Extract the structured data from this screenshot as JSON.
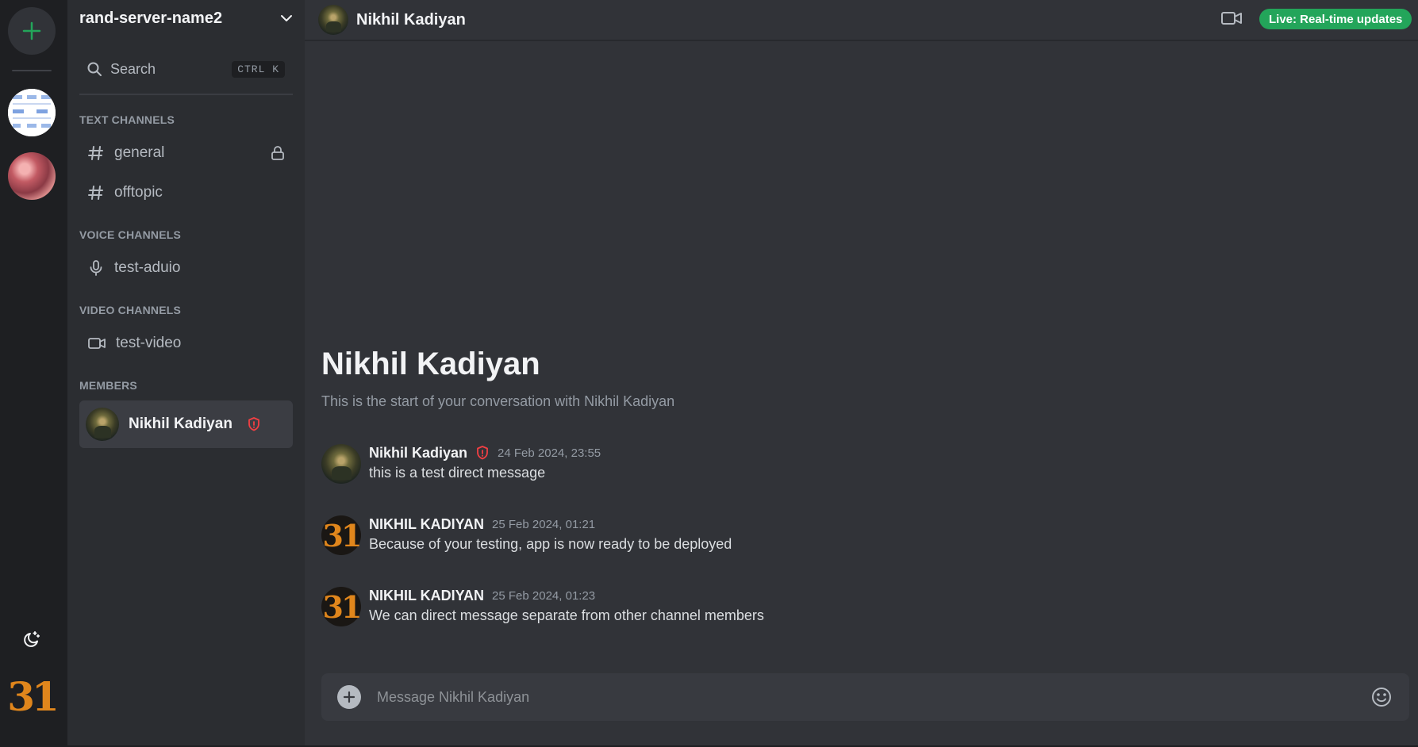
{
  "app": {
    "server_name": "rand-server-name2",
    "user_logo_text": "31"
  },
  "search": {
    "label": "Search",
    "shortcut": "CTRL  K"
  },
  "sections": {
    "text": "TEXT CHANNELS",
    "voice": "VOICE CHANNELS",
    "video": "VIDEO CHANNELS",
    "members": "MEMBERS"
  },
  "channels": {
    "text": [
      {
        "name": "general",
        "locked": true
      },
      {
        "name": "offtopic",
        "locked": false
      }
    ],
    "voice": [
      {
        "name": "test-aduio"
      }
    ],
    "video": [
      {
        "name": "test-video"
      }
    ]
  },
  "members": [
    {
      "name": "Nikhil Kadiyan",
      "role_icon": "shield-alert-icon"
    }
  ],
  "conversation": {
    "header_name": "Nikhil Kadiyan",
    "live_badge": "Live: Real-time updates",
    "welcome_title": "Nikhil Kadiyan",
    "welcome_subtitle": "This is the start of your conversation with Nikhil Kadiyan",
    "messages": [
      {
        "author": "Nikhil Kadiyan",
        "badge": "shield-alert-icon",
        "time": "24 Feb 2024, 23:55",
        "text": "this is a test direct message",
        "avatar": "photo"
      },
      {
        "author": "NIKHIL KADIYAN",
        "time": "25 Feb 2024, 01:21",
        "text": "Because of your testing, app is now ready to be deployed",
        "avatar": "31"
      },
      {
        "author": "NIKHIL KADIYAN",
        "time": "25 Feb 2024, 01:23",
        "text": "We can direct message separate from other channel members",
        "avatar": "31"
      }
    ],
    "composer_placeholder": "Message Nikhil Kadiyan"
  },
  "colors": {
    "accent_green": "#23a55a",
    "badge_red": "#f23f43",
    "logo_orange": "#e0861c"
  }
}
